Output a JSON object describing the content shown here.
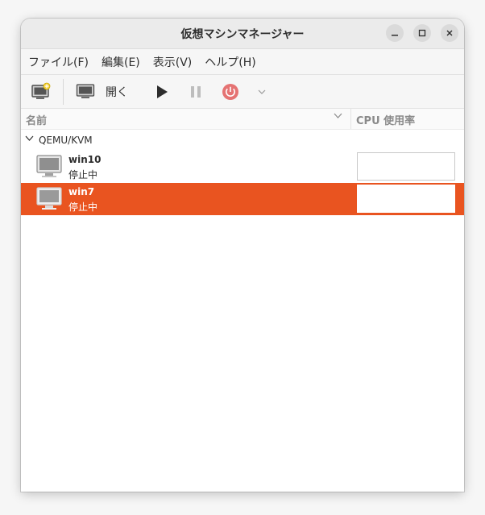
{
  "window": {
    "title": "仮想マシンマネージャー"
  },
  "menubar": {
    "items": [
      {
        "label": "ファイル(F)"
      },
      {
        "label": "編集(E)"
      },
      {
        "label": "表示(V)"
      },
      {
        "label": "ヘルプ(H)"
      }
    ]
  },
  "toolbar": {
    "open_label": "開く"
  },
  "list": {
    "columns": {
      "name": "名前",
      "cpu": "CPU 使用率"
    },
    "group": {
      "label": "QEMU/KVM"
    },
    "vms": [
      {
        "name": "win10",
        "status": "停止中",
        "selected": false
      },
      {
        "name": "win7",
        "status": "停止中",
        "selected": true
      }
    ]
  },
  "colors": {
    "accent": "#e95420",
    "power_icon": "#e57373"
  }
}
